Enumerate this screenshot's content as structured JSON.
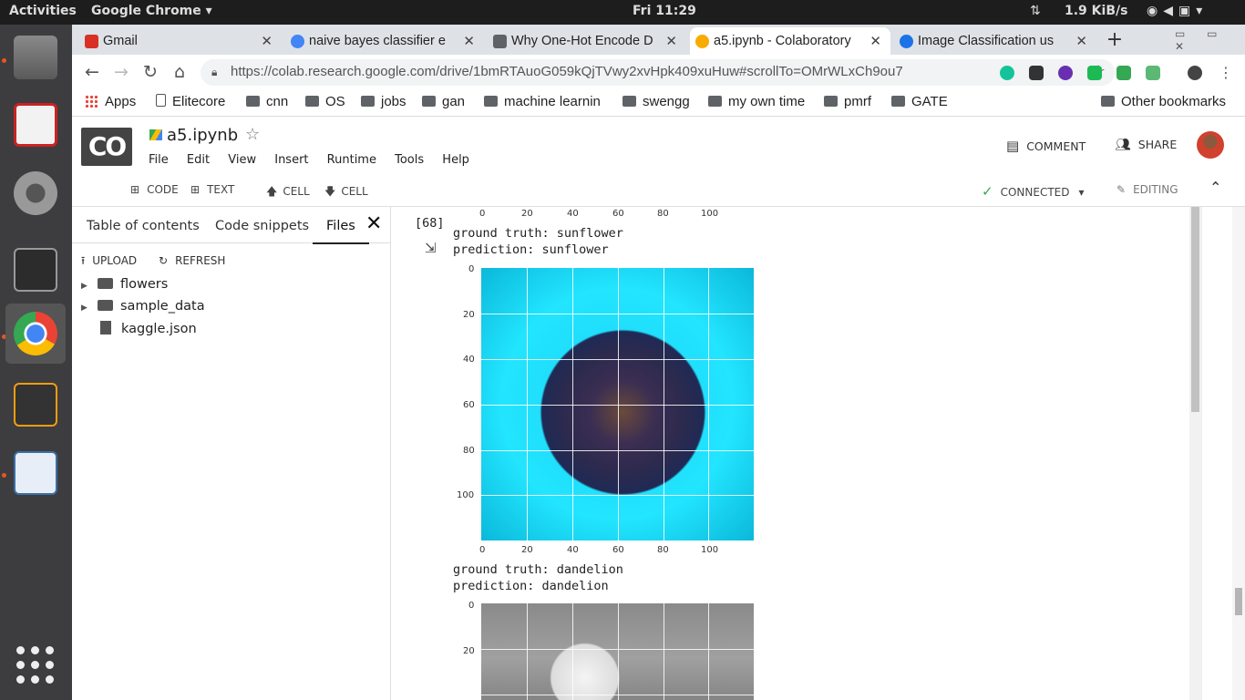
{
  "ubuntu": {
    "activities": "Activities",
    "app_menu": "Google Chrome ▾",
    "clock": "Fri 11:29",
    "net_speed": "1.9 KiB/s"
  },
  "tabs": [
    {
      "title": "Gmail",
      "favicon_color": "#d93025",
      "active": false
    },
    {
      "title": "naive bayes classifier e",
      "favicon_color": "#4285f4",
      "active": false
    },
    {
      "title": "Why One-Hot Encode D",
      "favicon_color": "#5f6368",
      "active": false
    },
    {
      "title": "a5.ipynb - Colaboratory",
      "favicon_color": "#f9ab00",
      "active": true
    },
    {
      "title": "Image Classification us",
      "favicon_color": "#1a73e8",
      "active": false
    }
  ],
  "omnibox": {
    "url": "https://colab.research.google.com/drive/1bmRTAuoG059kQjTVwy2xvHpk409xuHuw#scrollTo=OMrWLxCh9ou7"
  },
  "bookmarks": {
    "apps": "Apps",
    "items": [
      "Elitecore",
      "cnn",
      "OS",
      "jobs",
      "gan",
      "machine learnin",
      "swengg",
      "my own time",
      "pmrf",
      "GATE"
    ],
    "other": "Other bookmarks"
  },
  "colab": {
    "logo": "CO",
    "title": "a5.ipynb",
    "menus": [
      "File",
      "Edit",
      "View",
      "Insert",
      "Runtime",
      "Tools",
      "Help"
    ],
    "comment": "COMMENT",
    "share": "SHARE",
    "toolbar": {
      "add_code": "CODE",
      "add_text": "TEXT",
      "cell_up": "CELL",
      "cell_down": "CELL",
      "connected": "CONNECTED",
      "editing": "EDITING"
    }
  },
  "sidepanel": {
    "tabs": [
      "Table of contents",
      "Code snippets",
      "Files"
    ],
    "upload": "UPLOAD",
    "refresh": "REFRESH",
    "tree": [
      {
        "name": "flowers",
        "type": "folder"
      },
      {
        "name": "sample_data",
        "type": "folder"
      },
      {
        "name": "kaggle.json",
        "type": "file"
      }
    ]
  },
  "cell": {
    "exec_count": "[68]",
    "output1": {
      "line1": "ground truth: sunflower",
      "line2": "prediction: sunflower"
    },
    "output2": {
      "line1": "ground truth: dandelion",
      "line2": "prediction: dandelion"
    }
  },
  "plot_ticks": {
    "x": [
      "0",
      "20",
      "40",
      "60",
      "80",
      "100"
    ],
    "y": [
      "0",
      "20",
      "40",
      "60",
      "80",
      "100"
    ]
  }
}
